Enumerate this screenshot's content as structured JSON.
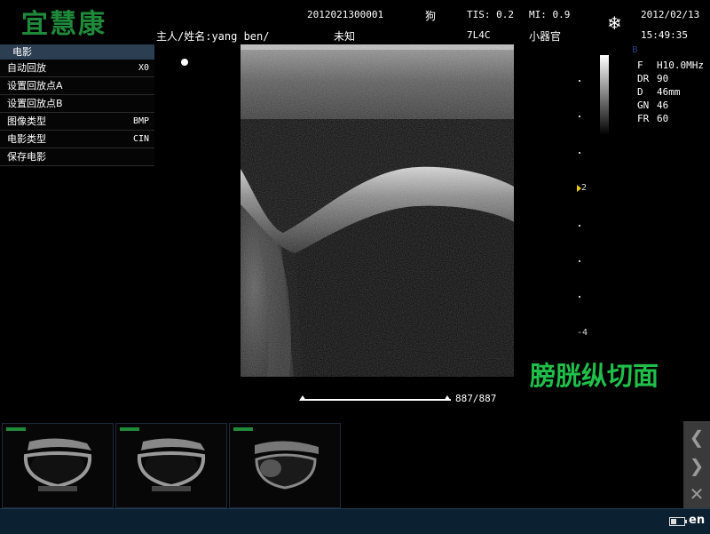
{
  "header": {
    "logo": "宜慧康",
    "patient_id": "2012021300001",
    "species": "狗",
    "tis": "TIS: 0.2",
    "mi": "MI: 0.9",
    "date": "2012/02/13",
    "owner_name": "主人/姓名:yang ben/",
    "sex": "未知",
    "probe": "7L4C",
    "exam": "小器官",
    "time": "15:49:35"
  },
  "cine_menu": {
    "title": "电影",
    "items": [
      {
        "label": "自动回放",
        "value": "X0"
      },
      {
        "label": "设置回放点A",
        "value": ""
      },
      {
        "label": "设置回放点B",
        "value": ""
      },
      {
        "label": "图像类型",
        "value": "BMP"
      },
      {
        "label": "电影类型",
        "value": "CIN"
      },
      {
        "label": "保存电影",
        "value": ""
      }
    ]
  },
  "params": {
    "mode": "B",
    "items": [
      {
        "key": "F",
        "value": "H10.0MHz"
      },
      {
        "key": "DR",
        "value": "90"
      },
      {
        "key": "D",
        "value": "46mm"
      },
      {
        "key": "GN",
        "value": "46"
      },
      {
        "key": "FR",
        "value": "60"
      }
    ]
  },
  "depth_scale": {
    "label_2": "2",
    "label_4": "-4"
  },
  "annotation": "膀胱纵切面",
  "cine": {
    "counter": "887/887",
    "progress": 1.0
  },
  "battery_level": 0.4,
  "language": "en",
  "icons": {
    "freeze": "snowflake-icon",
    "prev": "chevron-left-icon",
    "next": "chevron-right-icon",
    "close": "close-icon",
    "battery": "battery-icon"
  },
  "colors": {
    "logo": "#1e8a3a",
    "annotation": "#1fbf4a",
    "menu_header": "#2c3e52",
    "status_bar": "#0b2132",
    "focus_marker": "#f0d000"
  }
}
